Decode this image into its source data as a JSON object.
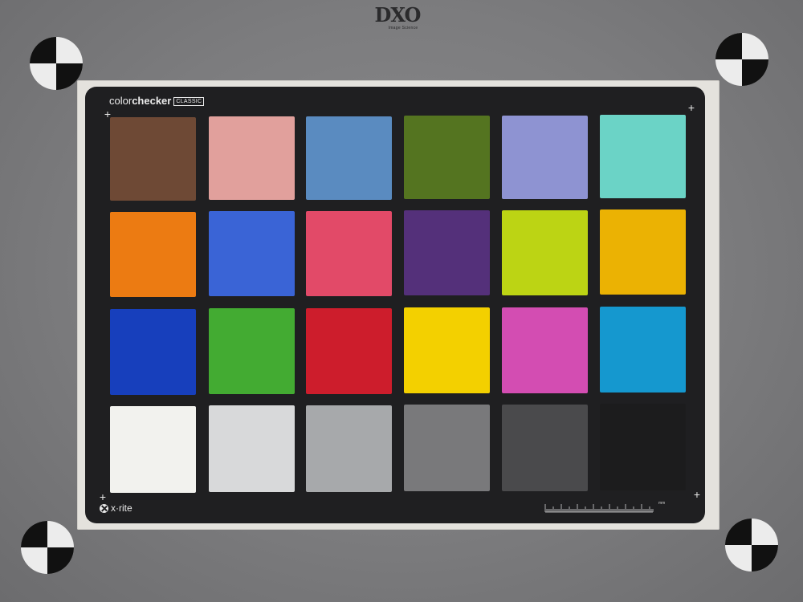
{
  "logo": {
    "main": "DXO",
    "sub": "Image Science"
  },
  "chart": {
    "brand_light": "color",
    "brand_bold": "checker",
    "brand_tag": "CLASSIC",
    "maker": "x·rite",
    "ruler_unit": "mm"
  },
  "patches": [
    [
      "#6e4935",
      "#e1a09c",
      "#5a8bc0",
      "#547420",
      "#8e93d2",
      "#6bd3c6"
    ],
    [
      "#ec7b12",
      "#3a64d6",
      "#e24a68",
      "#54307a",
      "#bcd414",
      "#ebb203"
    ],
    [
      "#173fbc",
      "#43ab32",
      "#cd1d2c",
      "#f3d000",
      "#d34db2",
      "#1598cf"
    ],
    [
      "#f2f2ee",
      "#d8d9da",
      "#a7a9ab",
      "#79797b",
      "#4a4a4c",
      "#1c1c1d"
    ]
  ]
}
